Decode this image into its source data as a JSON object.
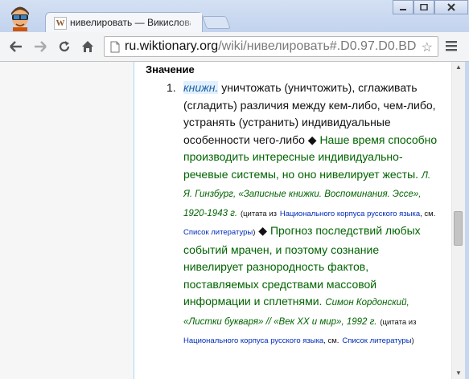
{
  "window": {
    "tab_title": "нивелировать — Викисловарь",
    "tab_favicon_letter": "W"
  },
  "toolbar": {
    "url_host": "ru.wiktionary.org",
    "url_path": "/wiki/нивелировать#.D0.97.D0.BD"
  },
  "article": {
    "section_heading": "Значение",
    "definitions": [
      {
        "number": "1.",
        "label": "книжн.",
        "text": "уничтожать (уничтожить), сглаживать (сгладить) различия между кем-либо, чем-либо, устранять (устранить) индивидуальные особенности чего-либо",
        "examples": [
          {
            "quote": "Наше время способно производить интересные индивидуально-речевые системы, но оно нивелирует жесты.",
            "source": "Л. Я. Гинзбург, «Записные книжки. Воспоминания. Эссе», 1920-1943 г.",
            "cite_open": "(цитата из",
            "corpus_link": "Национального корпуса русского языка",
            "cite_mid": ", см.",
            "list_link": "Список литературы",
            "cite_close": ")"
          },
          {
            "quote": "Прогноз последствий любых событий мрачен, и поэтому сознание нивелирует разнородность фактов, поставляемых средствами массовой информации и сплетнями.",
            "source": "Симон Кордонский, «Листки букваря» // «Век XX и мир», 1992 г.",
            "cite_open": "(цитата из",
            "corpus_link": "Национального корпуса русского языка",
            "cite_mid": ", см.",
            "list_link": "Список литературы",
            "cite_close": ")"
          }
        ]
      }
    ]
  },
  "icons": [
    "user-avatar-icon",
    "wiktionary-favicon-icon",
    "back-arrow-icon",
    "forward-arrow-icon",
    "reload-icon",
    "home-icon",
    "page-icon",
    "star-icon",
    "menu-icon"
  ]
}
